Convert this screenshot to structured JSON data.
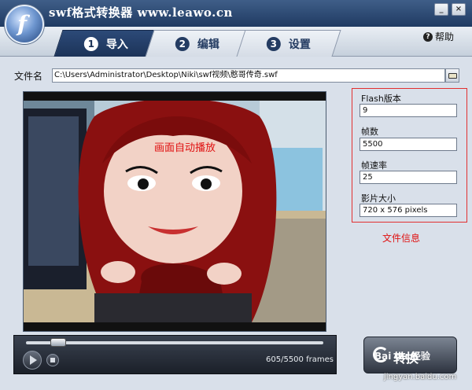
{
  "window": {
    "title": "swf格式转换器 www.leawo.cn",
    "minimize_glyph": "_",
    "close_glyph": "×"
  },
  "tabs": [
    {
      "number": "1",
      "label": "导入",
      "active": true
    },
    {
      "number": "2",
      "label": "编辑",
      "active": false
    },
    {
      "number": "3",
      "label": "设置",
      "active": false
    }
  ],
  "help": {
    "label": "帮助"
  },
  "file": {
    "label": "文件名",
    "path": "C:\\Users\\Administrator\\Desktop\\Niki\\swf视频\\憨哥传奇.swf"
  },
  "preview": {
    "annotation": "画面自动播放",
    "frames_text": "605/5500 frames",
    "progress": 0.11
  },
  "info": {
    "flash_version_label": "Flash版本",
    "flash_version": "9",
    "frame_count_label": "帧数",
    "frame_count": "5500",
    "frame_rate_label": "帧速率",
    "frame_rate": "25",
    "size_label": "影片大小",
    "size": "720 x 576 pixels",
    "caption": "文件信息"
  },
  "convert": {
    "label": "转换"
  },
  "watermark": {
    "logo_text": "Bai du 经验",
    "url": "jingyan.baidu.com"
  },
  "colors": {
    "accent": "#1c3358",
    "annotation": "#e01010"
  }
}
